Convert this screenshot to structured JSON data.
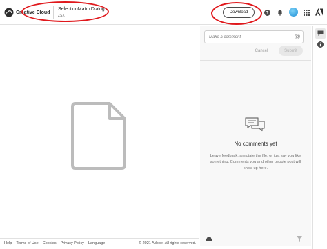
{
  "header": {
    "brand_name": "Creative Cloud",
    "file_title": "SelectionMatrixDialog",
    "file_type": "ZSX",
    "download_label": "Download",
    "accent_color": "#e0181c",
    "icons": [
      "creative-cloud-logo",
      "help-icon",
      "bell-icon",
      "avatar",
      "apps-grid-icon",
      "adobe-logo"
    ]
  },
  "comments": {
    "placeholder": "Make a comment",
    "cancel_label": "Cancel",
    "submit_label": "Submit",
    "empty_title": "No comments yet",
    "empty_description": "Leave feedback, annotate the file, or just say you like something. Comments you and other people post will show up here."
  },
  "footer": {
    "links": [
      "Help",
      "Terms of Use",
      "Cookies",
      "Privacy Policy",
      "Language"
    ],
    "copyright": "© 2021 Adobe. All rights reserved."
  }
}
